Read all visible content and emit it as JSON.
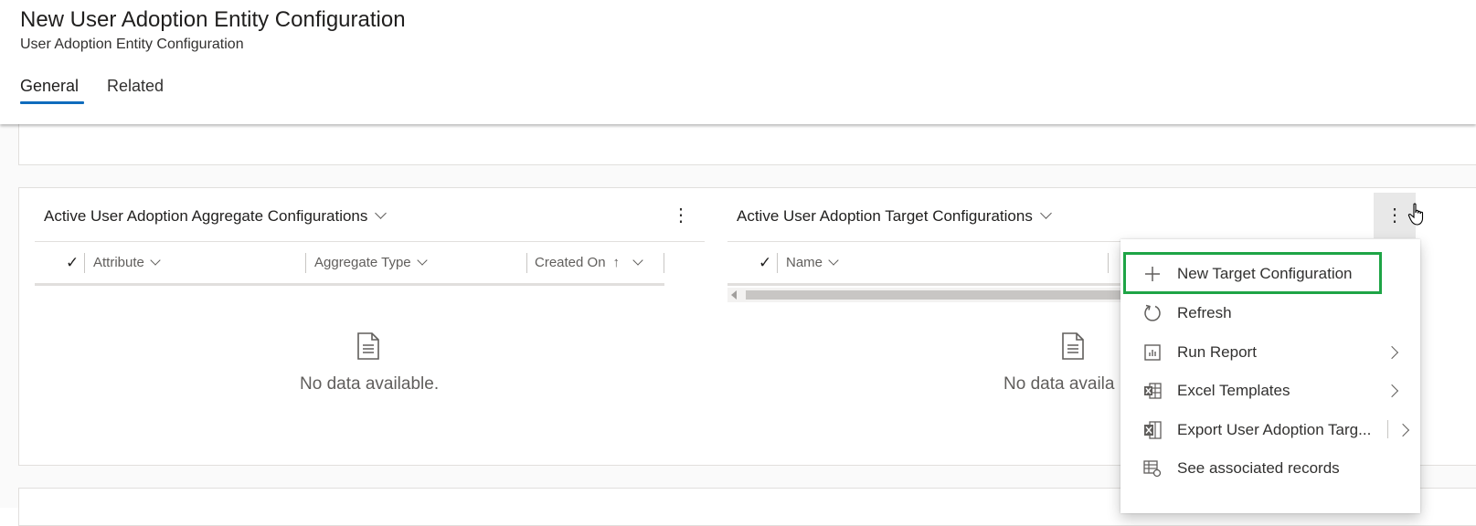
{
  "header": {
    "title": "New User Adoption Entity Configuration",
    "subtitle": "User Adoption Entity Configuration",
    "tabs": [
      {
        "label": "General",
        "selected": true
      },
      {
        "label": "Related",
        "selected": false
      }
    ]
  },
  "left_grid": {
    "title": "Active User Adoption Aggregate Configurations",
    "columns": [
      {
        "label": "Attribute"
      },
      {
        "label": "Aggregate Type"
      },
      {
        "label": "Created On",
        "sort": "ascending",
        "sort_glyph": "↑"
      }
    ],
    "empty_text": "No data available."
  },
  "right_grid": {
    "title": "Active User Adoption Target Configurations",
    "columns": [
      {
        "label": "Name"
      }
    ],
    "empty_text": "No data availa"
  },
  "menu": {
    "items": [
      {
        "label": "New Target Configuration",
        "icon": "plus-icon",
        "highlighted": true
      },
      {
        "label": "Refresh",
        "icon": "refresh-icon"
      },
      {
        "label": "Run Report",
        "icon": "report-icon",
        "submenu": true
      },
      {
        "label": "Excel Templates",
        "icon": "excel-template-icon",
        "submenu": true
      },
      {
        "label": "Export User Adoption Targ...",
        "icon": "excel-export-icon",
        "submenu": true,
        "split": true
      },
      {
        "label": "See associated records",
        "icon": "associated-records-icon"
      }
    ]
  },
  "icons": {
    "more_options": "⋮",
    "check": "✓"
  },
  "colors": {
    "accent": "#0f6cbd",
    "highlight": "#1ea446"
  }
}
